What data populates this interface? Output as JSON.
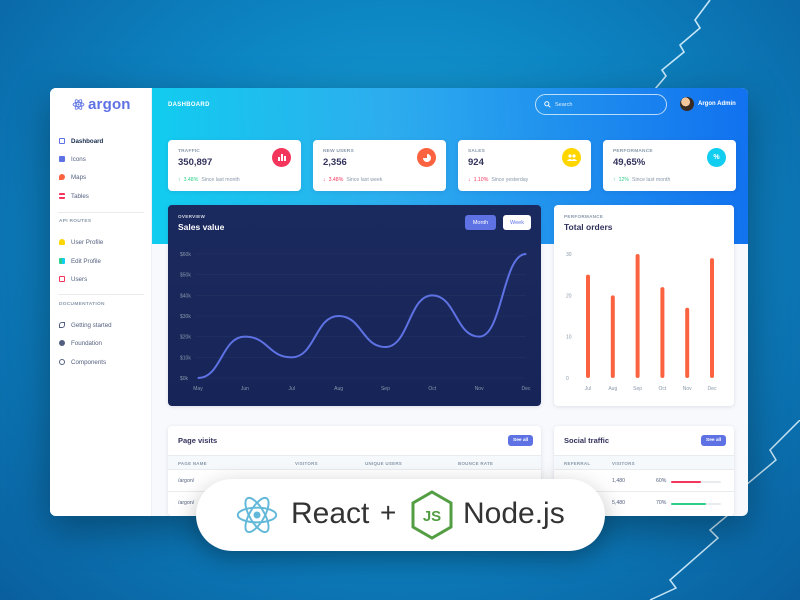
{
  "app": {
    "logo_text": "argon",
    "page_title": "DASHBOARD"
  },
  "search": {
    "placeholder": "Search"
  },
  "user": {
    "name": "Argon Admin"
  },
  "sidebar": {
    "items": [
      {
        "label": "Dashboard",
        "icon": "tv-icon",
        "color": "#5e72e4"
      },
      {
        "label": "Icons",
        "icon": "planet-icon",
        "color": "#5e72e4"
      },
      {
        "label": "Maps",
        "icon": "pin-icon",
        "color": "#fb6340"
      },
      {
        "label": "Tables",
        "icon": "list-icon",
        "color": "#f5365c"
      }
    ],
    "section1_title": "API ROUTES",
    "routes": [
      {
        "label": "User Profile",
        "icon": "user-icon",
        "color": "#ffd600"
      },
      {
        "label": "Edit Profile",
        "icon": "edit-icon",
        "color": "#2dce89"
      },
      {
        "label": "Users",
        "icon": "users-icon",
        "color": "#f5365c"
      }
    ],
    "section2_title": "DOCUMENTATION",
    "docs": [
      {
        "label": "Getting started",
        "icon": "spaceship-icon"
      },
      {
        "label": "Foundation",
        "icon": "palette-icon"
      },
      {
        "label": "Components",
        "icon": "ui-icon"
      }
    ]
  },
  "stats": [
    {
      "title": "TRAFFIC",
      "value": "350,897",
      "change": "3.48%",
      "direction": "up",
      "since": "Since last month",
      "icon": "chart-bar-icon",
      "icon_color": "#f5365c"
    },
    {
      "title": "NEW USERS",
      "value": "2,356",
      "change": "3.48%",
      "direction": "down",
      "since": "Since last week",
      "icon": "chart-pie-icon",
      "icon_color": "#fb6340"
    },
    {
      "title": "SALES",
      "value": "924",
      "change": "1.10%",
      "direction": "down",
      "since": "Since yesterday",
      "icon": "users-icon",
      "icon_color": "#ffd600"
    },
    {
      "title": "PERFORMANCE",
      "value": "49,65%",
      "change": "12%",
      "direction": "up",
      "since": "Since last month",
      "icon": "percent-icon",
      "icon_color": "#11cdef"
    }
  ],
  "sales_card": {
    "overline": "OVERVIEW",
    "title": "Sales value",
    "btn_month": "Month",
    "btn_week": "Week"
  },
  "orders_card": {
    "overline": "PERFORMANCE",
    "title": "Total orders"
  },
  "page_visits": {
    "title": "Page visits",
    "see_all": "See all",
    "headers": [
      "PAGE NAME",
      "VISITORS",
      "UNIQUE USERS",
      "BOUNCE RATE"
    ],
    "rows": [
      {
        "page": "/argon/"
      },
      {
        "page": "/argon/"
      }
    ]
  },
  "social": {
    "title": "Social traffic",
    "see_all": "See all",
    "headers": [
      "REFERRAL",
      "VISITORS"
    ],
    "rows": [
      {
        "visitors": "1,480",
        "percent": "60%",
        "value": 0.6,
        "color": "#f5365c"
      },
      {
        "visitors": "5,480",
        "percent": "70%",
        "value": 0.7,
        "color": "#2dce89"
      }
    ]
  },
  "badge": {
    "react": "React",
    "plus": "+",
    "node": "Node.js",
    "js_mark": "JS"
  },
  "chart_data": [
    {
      "type": "line",
      "title": "Sales value",
      "categories": [
        "May",
        "Jun",
        "Jul",
        "Aug",
        "Sep",
        "Oct",
        "Nov",
        "Dec"
      ],
      "values": [
        0,
        20,
        10,
        30,
        15,
        40,
        20,
        60
      ],
      "yticks": [
        "$0k",
        "$10k",
        "$20k",
        "$30k",
        "$40k",
        "$50k",
        "$60k"
      ],
      "ylim": [
        0,
        60
      ],
      "line_color": "#5e72e4"
    },
    {
      "type": "bar",
      "title": "Total orders",
      "categories": [
        "Jul",
        "Aug",
        "Sep",
        "Oct",
        "Nov",
        "Dec"
      ],
      "values": [
        25,
        20,
        30,
        22,
        17,
        29
      ],
      "yticks": [
        "0",
        "10",
        "20",
        "30"
      ],
      "ylim": [
        0,
        30
      ],
      "bar_color": "#fb6340"
    }
  ]
}
